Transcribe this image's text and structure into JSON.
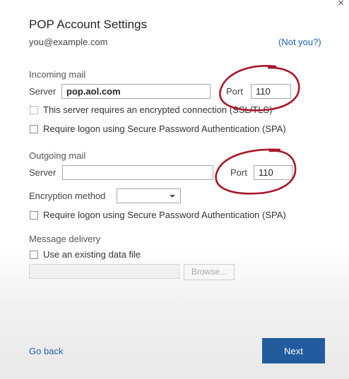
{
  "dialog": {
    "title": "POP Account Settings",
    "email": "you@example.com",
    "not_you": "(Not you?)"
  },
  "incoming": {
    "section_label": "Incoming mail",
    "server_label": "Server",
    "server_value": "pop.aol.com",
    "port_label": "Port",
    "port_value": "110",
    "ssl_label": "This server requires an encrypted connection (SSL/TLS)",
    "spa_label": "Require logon using Secure Password Authentication (SPA)"
  },
  "outgoing": {
    "section_label": "Outgoing mail",
    "server_label": "Server",
    "server_value": "",
    "port_label": "Port",
    "port_value": "110",
    "encryption_label": "Encryption method",
    "encryption_value": "",
    "spa_label": "Require logon using Secure Password Authentication (SPA)"
  },
  "delivery": {
    "section_label": "Message delivery",
    "existing_label": "Use an existing data file",
    "file_path": "",
    "browse_label": "Browse..."
  },
  "footer": {
    "go_back": "Go back",
    "next": "Next"
  },
  "colors": {
    "accent": "#225c9f",
    "link": "#1f62b0",
    "annotation": "#a8172b"
  }
}
